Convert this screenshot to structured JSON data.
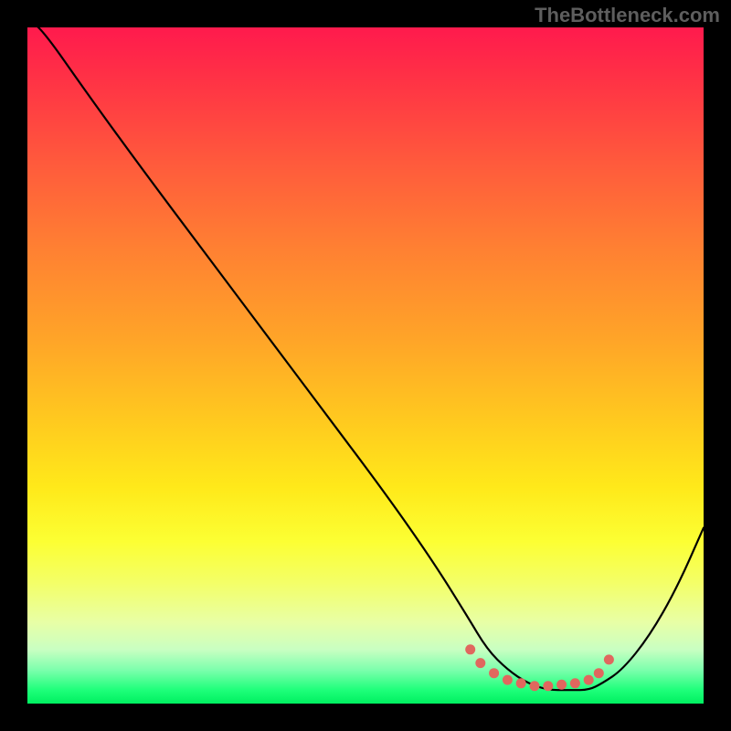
{
  "watermark": "TheBottleneck.com",
  "chart_data": {
    "type": "line",
    "title": "",
    "xlabel": "",
    "ylabel": "",
    "xlim": [
      0,
      100
    ],
    "ylim": [
      0,
      100
    ],
    "gradient_meaning": "background: top=red (bad), bottom=green (good)",
    "series": [
      {
        "name": "bottleneck-curve",
        "x": [
          0,
          2,
          9,
          17,
          26,
          35,
          44,
          53,
          60,
          65,
          68,
          71,
          74,
          77,
          80,
          83,
          85,
          88,
          92,
          96,
          100
        ],
        "y": [
          101,
          100,
          90,
          79,
          67,
          55,
          43,
          31,
          21,
          13,
          8,
          5,
          3,
          2,
          2,
          2,
          3,
          5,
          10,
          17,
          26
        ]
      }
    ],
    "highlight_points": {
      "name": "flat-minimum-dots",
      "color": "#e0675e",
      "x": [
        65.5,
        67,
        69,
        71,
        73,
        75,
        77,
        79,
        81,
        83,
        84.5,
        86
      ],
      "y": [
        8,
        6,
        4.5,
        3.5,
        3,
        2.6,
        2.6,
        2.8,
        3,
        3.5,
        4.5,
        6.5
      ]
    }
  }
}
